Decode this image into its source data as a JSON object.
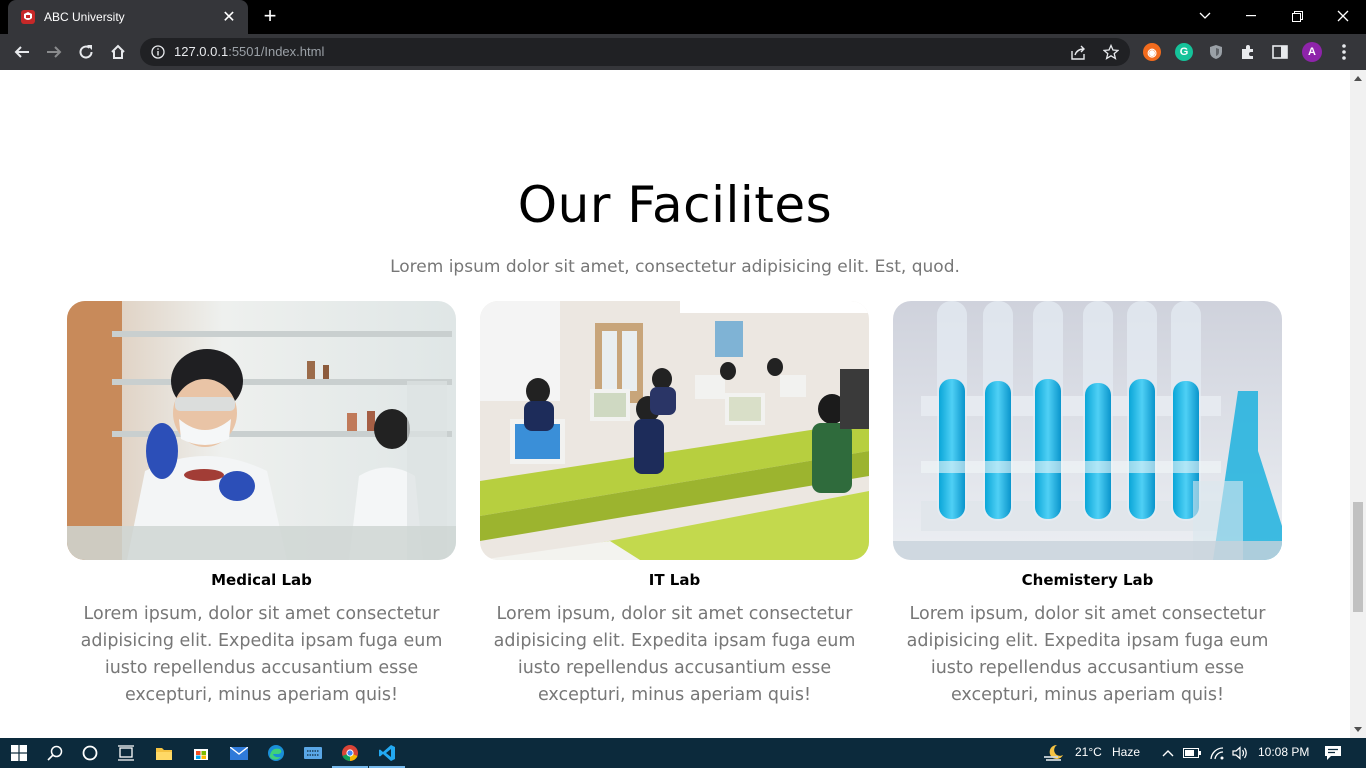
{
  "browser": {
    "tab_title": "ABC University",
    "url_host": "127.0.0.1",
    "url_rest": ":5501/Index.html",
    "profile_initial": "A"
  },
  "page": {
    "section_title": "Our Facilites",
    "section_subtitle": "Lorem ipsum dolor sit amet, consectetur adipisicing elit. Est, quod.",
    "cards": [
      {
        "title": "Medical Lab",
        "text": "Lorem ipsum, dolor sit amet consectetur adipisicing elit. Expedita ipsam fuga eum iusto repellendus accusantium esse excepturi, minus aperiam quis!",
        "image": "medical-lab-photo"
      },
      {
        "title": "IT Lab",
        "text": "Lorem ipsum, dolor sit amet consectetur adipisicing elit. Expedita ipsam fuga eum iusto repellendus accusantium esse excepturi, minus aperiam quis!",
        "image": "it-lab-photo"
      },
      {
        "title": "Chemistery Lab",
        "text": "Lorem ipsum, dolor sit amet consectetur adipisicing elit. Expedita ipsam fuga eum iusto repellendus accusantium esse excepturi, minus aperiam quis!",
        "image": "chemistry-lab-photo"
      }
    ]
  },
  "taskbar": {
    "temperature": "21°C",
    "weather": "Haze",
    "time": "10:08 PM"
  },
  "colors": {
    "chrome_dark": "#35363a",
    "taskbar": "#0c2a3c",
    "body_text": "#777777"
  }
}
